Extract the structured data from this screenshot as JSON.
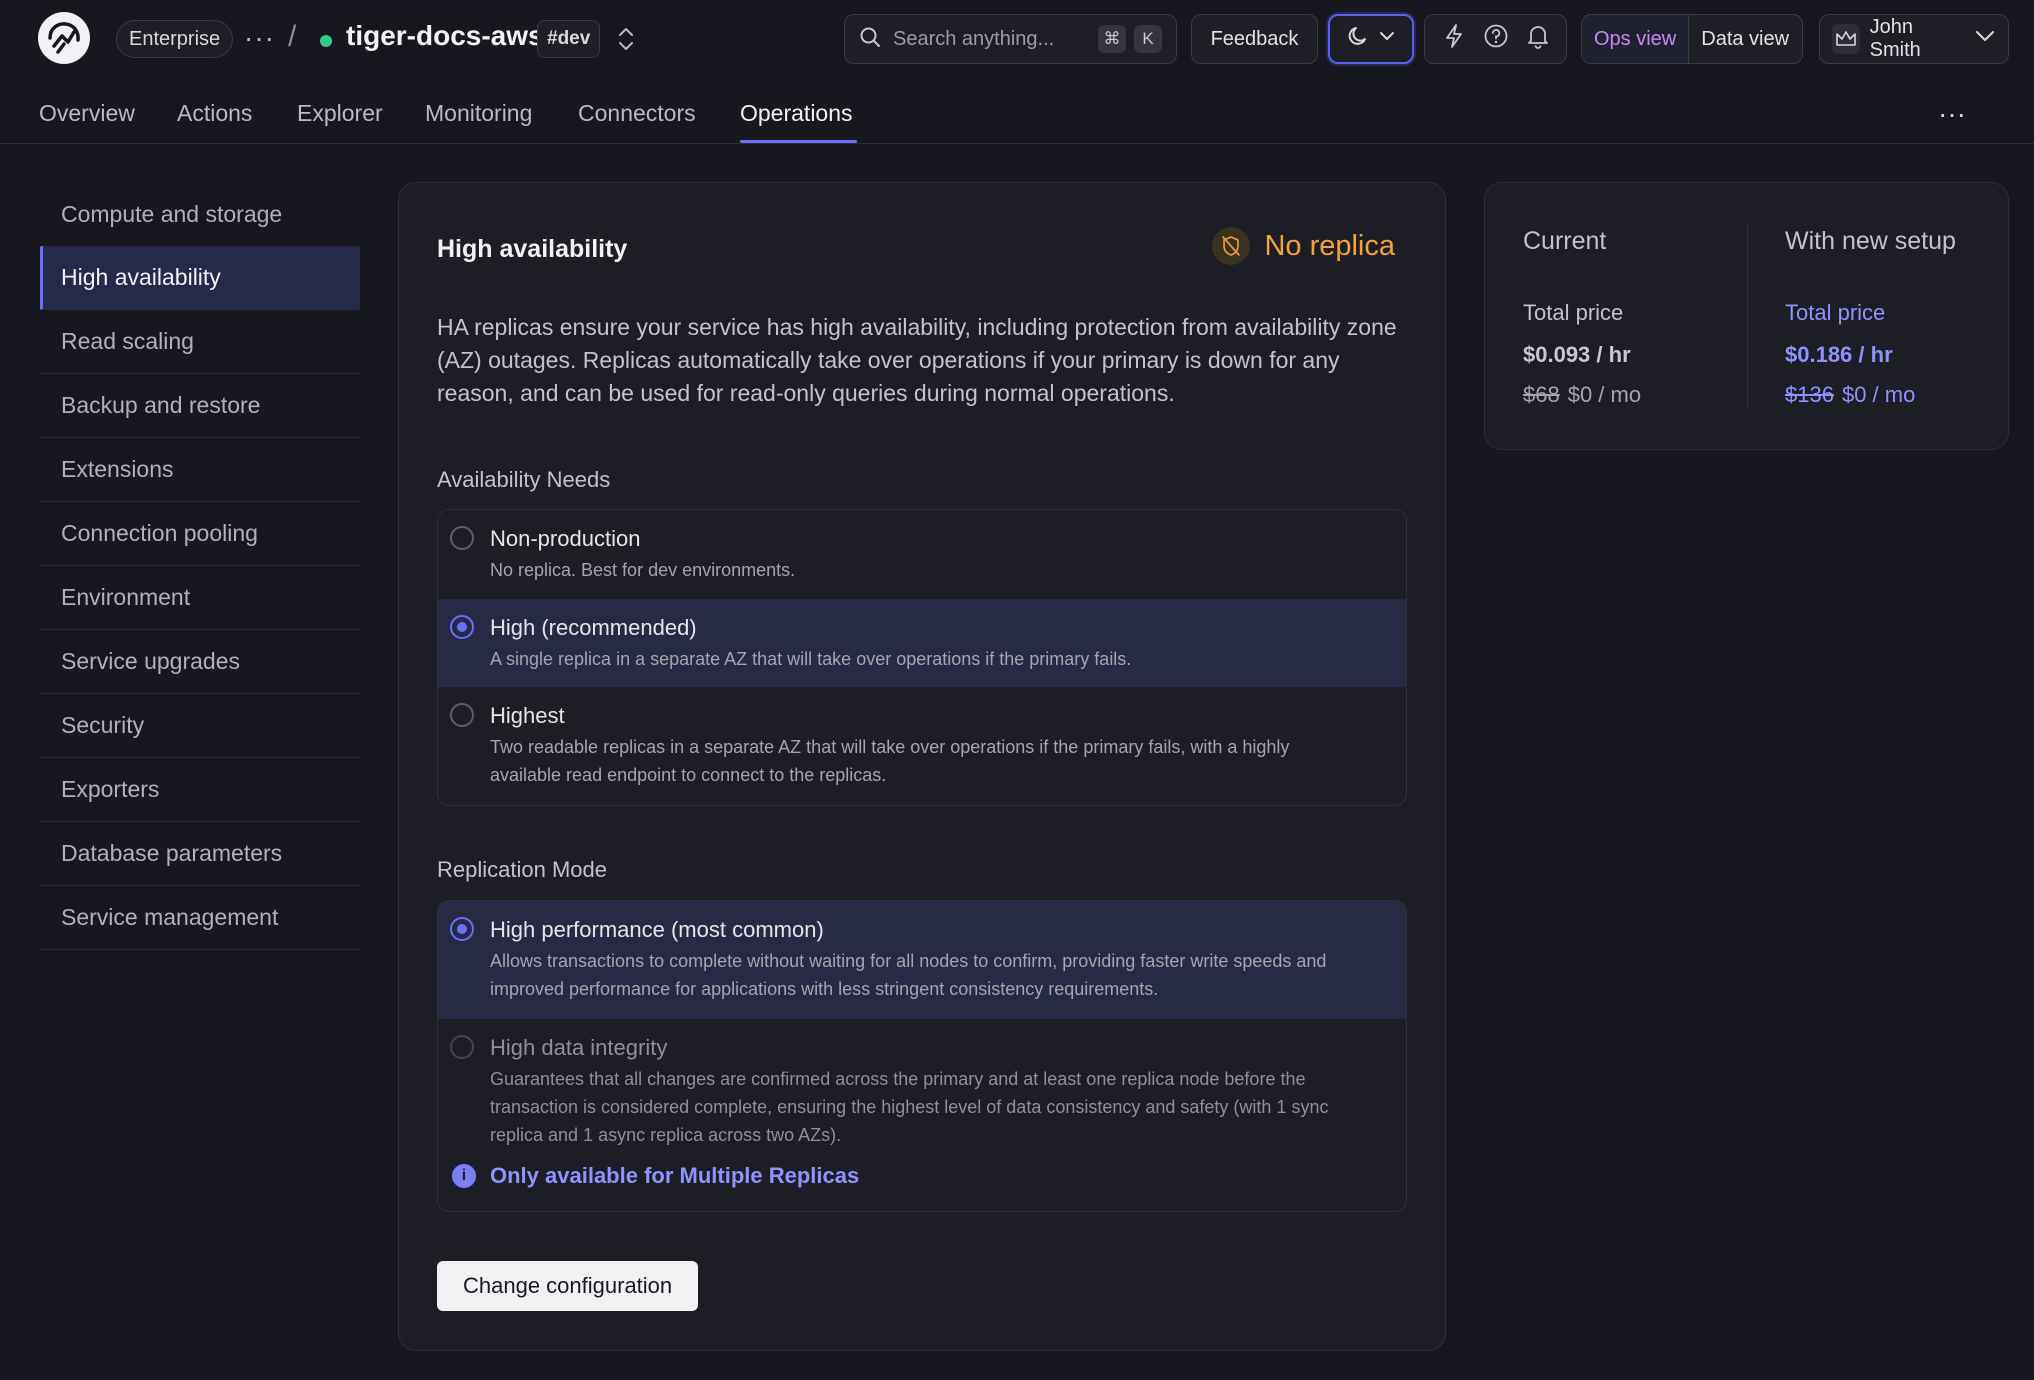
{
  "header": {
    "plan": "Enterprise",
    "more": "···",
    "separator": "/",
    "service_name": "tiger-docs-aws",
    "env_tag": "#dev",
    "search_placeholder": "Search anything...",
    "search_shortcut_mod": "⌘",
    "search_shortcut_key": "K",
    "feedback_label": "Feedback",
    "ops_view_label": "Ops view",
    "data_view_label": "Data view",
    "user_name": "John Smith",
    "colors": {
      "status": "#37c88b",
      "ops_view": "#c78af5",
      "accent": "#6b70ff"
    }
  },
  "tabs": [
    {
      "label": "Overview"
    },
    {
      "label": "Actions"
    },
    {
      "label": "Explorer"
    },
    {
      "label": "Monitoring"
    },
    {
      "label": "Connectors"
    },
    {
      "label": "Operations"
    }
  ],
  "active_tab": "Operations",
  "tabs_more": "···",
  "sidebar": {
    "items": [
      {
        "label": "Compute and storage"
      },
      {
        "label": "High availability"
      },
      {
        "label": "Read scaling"
      },
      {
        "label": "Backup and restore"
      },
      {
        "label": "Extensions"
      },
      {
        "label": "Connection pooling"
      },
      {
        "label": "Environment"
      },
      {
        "label": "Service upgrades"
      },
      {
        "label": "Security"
      },
      {
        "label": "Exporters"
      },
      {
        "label": "Database parameters"
      },
      {
        "label": "Service management"
      }
    ],
    "active": "High availability"
  },
  "main": {
    "title": "High availability",
    "status": "No replica",
    "status_color": "#f0a43a",
    "description": "HA replicas ensure your service has high availability, including protection from availability zone (AZ) outages. Replicas automatically take over operations if your primary is down for any reason, and can be used for read-only queries during normal operations.",
    "availability": {
      "label": "Availability Needs",
      "options": [
        {
          "title": "Non-production",
          "desc": "No replica. Best for dev environments."
        },
        {
          "title": "High (recommended)",
          "desc": "A single replica in a separate AZ that will take over operations if the primary fails."
        },
        {
          "title": "Highest",
          "desc": "Two readable replicas in a separate AZ that will take over operations if the primary fails, with a highly available read endpoint to connect to the replicas."
        }
      ],
      "selected": "High (recommended)"
    },
    "replication": {
      "label": "Replication Mode",
      "options": [
        {
          "title": "High performance (most common)",
          "desc": "Allows transactions to complete without waiting for all nodes to confirm, providing faster write speeds and improved performance for applications with less stringent consistency requirements."
        },
        {
          "title": "High data integrity",
          "desc": "Guarantees that all changes are confirmed across the primary and at least one replica node before the transaction is considered complete, ensuring the highest level of data consistency and safety (with 1 sync replica and 1 async replica across two AZs).",
          "note": "Only available for Multiple Replicas"
        }
      ],
      "selected": "High performance (most common)"
    },
    "change_button": "Change configuration"
  },
  "pricing": {
    "current": {
      "heading": "Current",
      "label": "Total price",
      "hourly": "$0.093 / hr",
      "old_monthly": "$68",
      "monthly": "$0 / mo"
    },
    "new": {
      "heading": "With new setup",
      "label": "Total price",
      "hourly": "$0.186 / hr",
      "old_monthly": "$136",
      "monthly": "$0 / mo"
    }
  }
}
